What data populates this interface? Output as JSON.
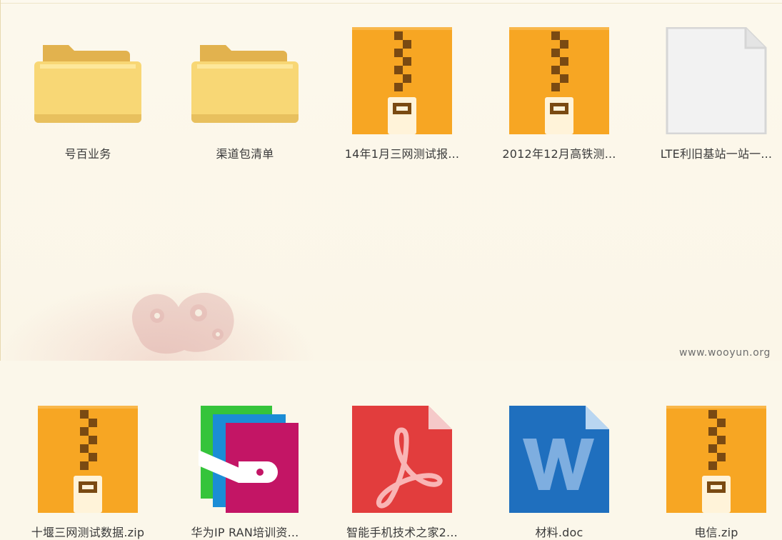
{
  "files": [
    {
      "name": "号百业务",
      "type": "folder"
    },
    {
      "name": "渠道包清单",
      "type": "folder"
    },
    {
      "name": "14年1月三网测试报...",
      "type": "zip"
    },
    {
      "name": "2012年12月高铁测...",
      "type": "zip"
    },
    {
      "name": "LTE利旧基站一站一...",
      "type": "blank"
    },
    {
      "name": "十堰三网测试数据.zip",
      "type": "zip"
    },
    {
      "name": "华为IP RAN培训资...",
      "type": "office-setup"
    },
    {
      "name": "智能手机技术之家2...",
      "type": "pdf"
    },
    {
      "name": "材料.doc",
      "type": "doc"
    },
    {
      "name": "电信.zip",
      "type": "zip"
    }
  ],
  "watermark": "www.wooyun.org",
  "colors": {
    "background": "#fbf7ea",
    "folder": "#f8d775",
    "zip": "#f7a623",
    "zip_teeth": "#7a4a12",
    "pdf": "#e23d3d",
    "doc": "#1f6fbe",
    "blank": "#f1f1f1"
  }
}
